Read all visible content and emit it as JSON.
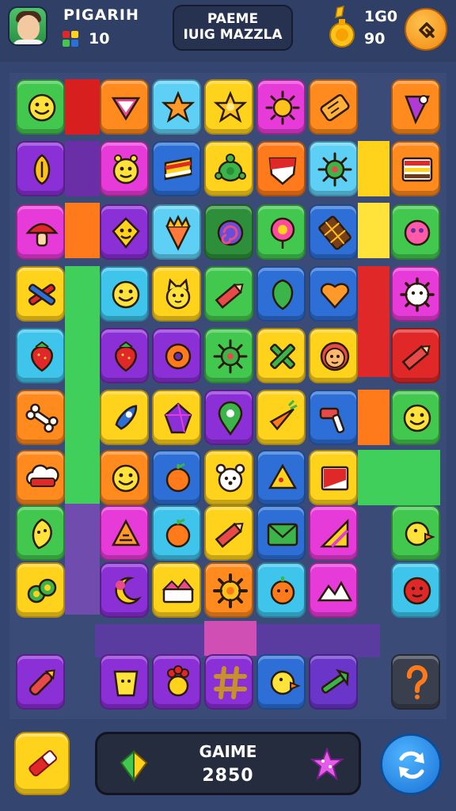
{
  "header": {
    "player_name": "PIGARIH",
    "player_count": "10",
    "title_line1": "PAEME",
    "title_line2": "IUIG MAZZLA",
    "stat_top": "1G0",
    "stat_bottom": "90",
    "avatar_icon": "player-avatar",
    "gem_icon": "gem-icon",
    "trophy_icon": "trophy-icon",
    "settings_icon": "settings-icon"
  },
  "footer": {
    "score_label": "GAIME",
    "score_value": "2850",
    "tool_icon": "pencil-eraser-icon",
    "refresh_icon": "refresh-icon"
  },
  "colors": {
    "background": "#34466f",
    "yellow": "#ffd21c",
    "orange": "#ff8a1e",
    "green": "#43c84f",
    "purple": "#8b2fd6",
    "magenta": "#e63bd8",
    "blue": "#2d6fd6",
    "cyan": "#3fc4ec",
    "red": "#e02828"
  },
  "board": {
    "rows": [
      [
        {
          "col": 0,
          "color": "#43c84f",
          "icon": "smiley-face"
        },
        {
          "col": 2,
          "color": "#ff8a1e",
          "icon": "triangle-gem"
        },
        {
          "col": 3,
          "color": "#5fd0f5",
          "icon": "star-face"
        },
        {
          "col": 4,
          "color": "#ffd21c",
          "icon": "star"
        },
        {
          "col": 5,
          "color": "#e63bd8",
          "icon": "sun"
        },
        {
          "col": 6,
          "color": "#ff8a1e",
          "icon": "tag"
        },
        {
          "col": 8,
          "color": "#ff8a1e",
          "icon": "cone"
        }
      ],
      [
        {
          "col": 0,
          "color": "#8b2fd6",
          "icon": "seed"
        },
        {
          "col": 2,
          "color": "#e63bd8",
          "icon": "monster-face"
        },
        {
          "col": 3,
          "color": "#2d6fd6",
          "icon": "book"
        },
        {
          "col": 4,
          "color": "#ffd21c",
          "icon": "turtle"
        },
        {
          "col": 5,
          "color": "#ff7a1a",
          "icon": "shield"
        },
        {
          "col": 6,
          "color": "#5fd0f5",
          "icon": "virus"
        },
        {
          "col": 8,
          "color": "#ff8a1e",
          "icon": "stripes"
        }
      ],
      [
        {
          "col": 0,
          "color": "#e63bd8",
          "icon": "mushroom"
        },
        {
          "col": 2,
          "color": "#8b2fd6",
          "icon": "diamond-face"
        },
        {
          "col": 3,
          "color": "#5fd0f5",
          "icon": "spiky-cone"
        },
        {
          "col": 4,
          "color": "#2e8f3a",
          "icon": "swirl"
        },
        {
          "col": 5,
          "color": "#43c84f",
          "icon": "balloon"
        },
        {
          "col": 6,
          "color": "#2d6fd6",
          "icon": "chocolate"
        },
        {
          "col": 8,
          "color": "#43c84f",
          "icon": "blob"
        }
      ],
      [
        {
          "col": 0,
          "color": "#ffd21c",
          "icon": "tools"
        },
        {
          "col": 2,
          "color": "#3fc4ec",
          "icon": "smiley-face"
        },
        {
          "col": 3,
          "color": "#ffd21c",
          "icon": "cat-face"
        },
        {
          "col": 4,
          "color": "#43c84f",
          "icon": "pencil"
        },
        {
          "col": 5,
          "color": "#2d6fd6",
          "icon": "leaf"
        },
        {
          "col": 6,
          "color": "#2d6fd6",
          "icon": "heart"
        },
        {
          "col": 8,
          "color": "#e63bd8",
          "icon": "gear-face"
        }
      ],
      [
        {
          "col": 0,
          "color": "#3fc4ec",
          "icon": "strawberry"
        },
        {
          "col": 2,
          "color": "#8b2fd6",
          "icon": "strawberry"
        },
        {
          "col": 3,
          "color": "#8b2fd6",
          "icon": "donut"
        },
        {
          "col": 4,
          "color": "#43c84f",
          "icon": "virus"
        },
        {
          "col": 5,
          "color": "#ffd21c",
          "icon": "cross-tool"
        },
        {
          "col": 6,
          "color": "#ffd21c",
          "icon": "lion-face"
        },
        {
          "col": 8,
          "color": "#e02828",
          "icon": "pencil"
        }
      ],
      [
        {
          "col": 0,
          "color": "#ff8a1e",
          "icon": "bone"
        },
        {
          "col": 2,
          "color": "#ffd21c",
          "icon": "rocket"
        },
        {
          "col": 3,
          "color": "#ffd21c",
          "icon": "crystal"
        },
        {
          "col": 4,
          "color": "#8b2fd6",
          "icon": "pin"
        },
        {
          "col": 5,
          "color": "#ffd21c",
          "icon": "carrot"
        },
        {
          "col": 6,
          "color": "#2d6fd6",
          "icon": "toothbrush"
        },
        {
          "col": 8,
          "color": "#43c84f",
          "icon": "smiley-face"
        }
      ],
      [
        {
          "col": 0,
          "color": "#ff8a1e",
          "icon": "cloud-face"
        },
        {
          "col": 2,
          "color": "#ff8a1e",
          "icon": "smiley-face"
        },
        {
          "col": 3,
          "color": "#2d6fd6",
          "icon": "orange-fruit"
        },
        {
          "col": 4,
          "color": "#ffd21c",
          "icon": "bear-face"
        },
        {
          "col": 5,
          "color": "#2d6fd6",
          "icon": "cheese"
        },
        {
          "col": 6,
          "color": "#ffd21c",
          "icon": "flag"
        }
      ],
      [
        {
          "col": 0,
          "color": "#43c84f",
          "icon": "leaf-face"
        },
        {
          "col": 2,
          "color": "#e63bd8",
          "icon": "triangle"
        },
        {
          "col": 3,
          "color": "#3fc4ec",
          "icon": "orange-fruit"
        },
        {
          "col": 4,
          "color": "#ffd21c",
          "icon": "pencil"
        },
        {
          "col": 5,
          "color": "#2d6fd6",
          "icon": "envelope"
        },
        {
          "col": 6,
          "color": "#e63bd8",
          "icon": "ruler"
        },
        {
          "col": 8,
          "color": "#43c84f",
          "icon": "chick"
        }
      ],
      [
        {
          "col": 0,
          "color": "#ffd21c",
          "icon": "rings"
        },
        {
          "col": 2,
          "color": "#8b2fd6",
          "icon": "moon"
        },
        {
          "col": 3,
          "color": "#ffd21c",
          "icon": "cake"
        },
        {
          "col": 4,
          "color": "#ff8a1e",
          "icon": "gear"
        },
        {
          "col": 5,
          "color": "#3fc4ec",
          "icon": "pumpkin"
        },
        {
          "col": 6,
          "color": "#e63bd8",
          "icon": "mountain"
        },
        {
          "col": 8,
          "color": "#3fc4ec",
          "icon": "red-ball"
        }
      ],
      [
        {
          "col": 0,
          "color": "#8b2fd6",
          "icon": "crayon"
        },
        {
          "col": 2,
          "color": "#8b2fd6",
          "icon": "cheese-face"
        },
        {
          "col": 3,
          "color": "#8b2fd6",
          "icon": "flower"
        },
        {
          "col": 4,
          "color": "#8b2fd6",
          "icon": "hashtag"
        },
        {
          "col": 5,
          "color": "#2d6fd6",
          "icon": "chick"
        },
        {
          "col": 6,
          "color": "#6a35c9",
          "icon": "fish-tool"
        },
        {
          "col": 8,
          "color": "#3a3f4d",
          "icon": "question-mark"
        }
      ]
    ]
  }
}
